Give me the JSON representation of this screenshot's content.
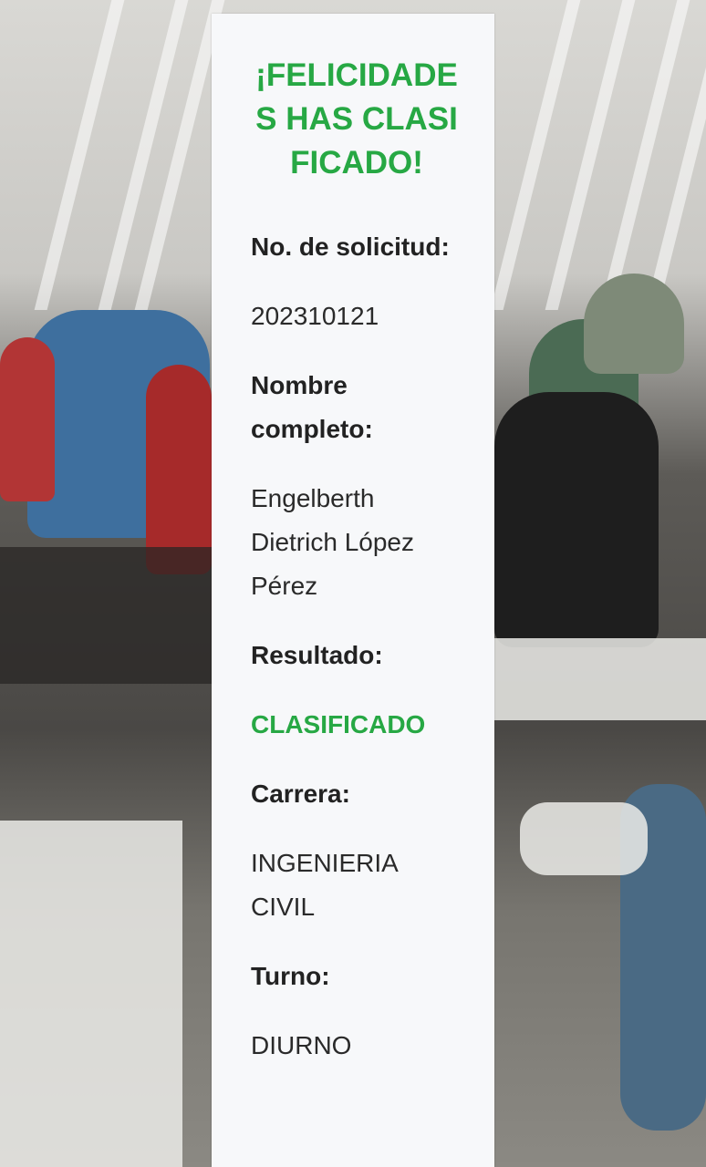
{
  "card": {
    "title": "¡FELICIDADES HAS CLASIFICADO!",
    "fields": [
      {
        "label": "No. de solicitud:",
        "value": "202310121"
      },
      {
        "label": "Nombre completo:",
        "value": "Engelberth Dietrich López Pérez"
      },
      {
        "label": "Resultado:",
        "value": "CLASIFICADO"
      },
      {
        "label": "Carrera:",
        "value": "INGENIERIA CIVIL"
      },
      {
        "label": "Turno:",
        "value": "DIURNO"
      }
    ]
  },
  "colors": {
    "success": "#27a844",
    "card_background": "#f7f8fa"
  }
}
